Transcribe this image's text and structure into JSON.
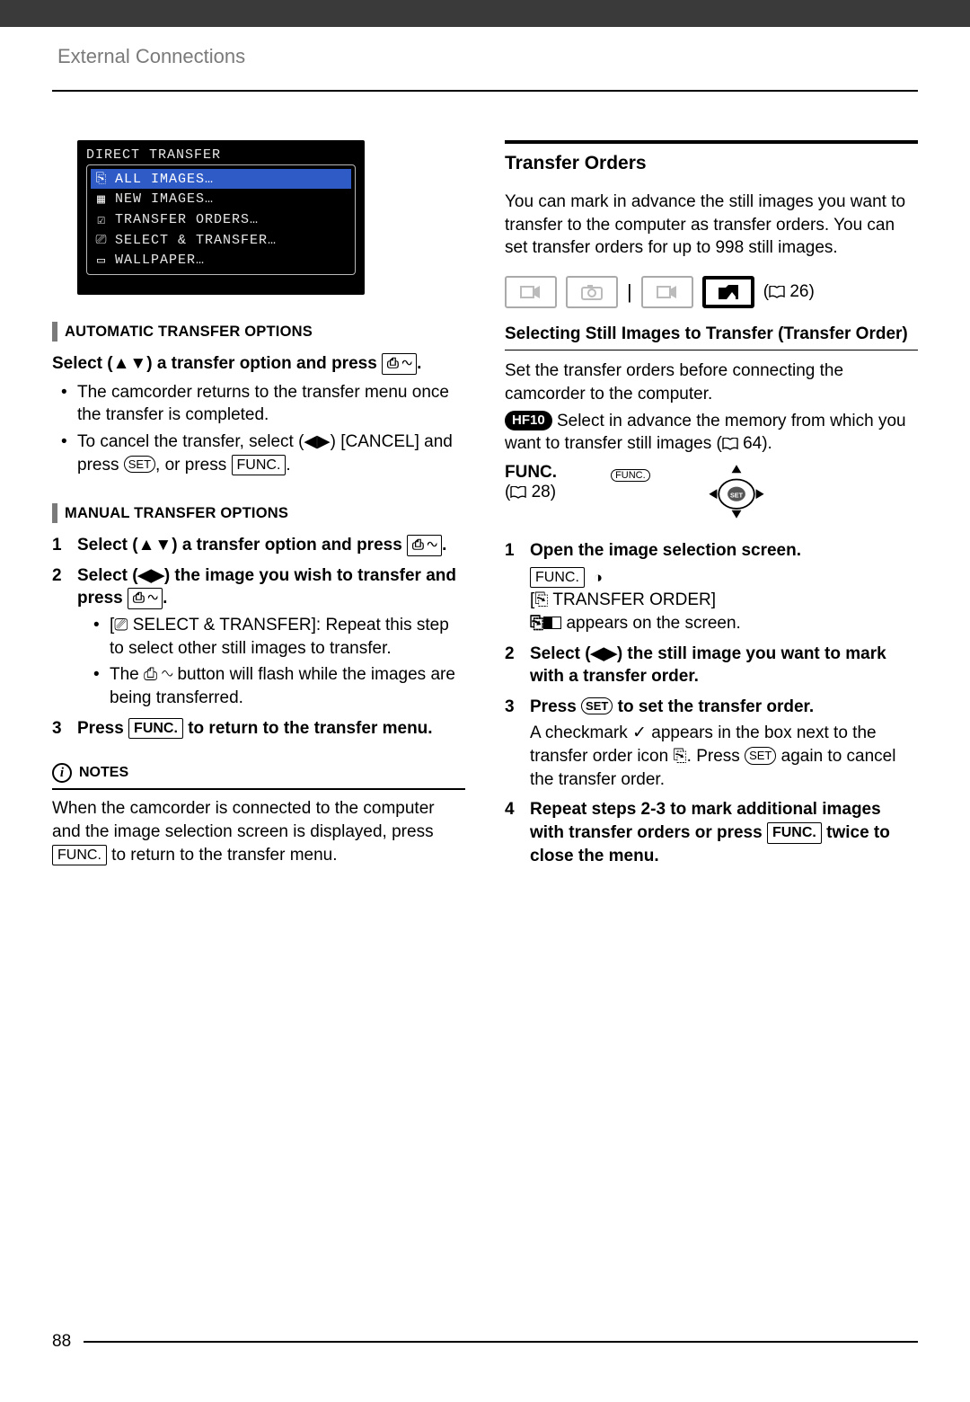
{
  "breadcrumb": "External Connections",
  "page_number": "88",
  "lcd": {
    "title": "DIRECT TRANSFER",
    "items": [
      {
        "label": "ALL IMAGES…"
      },
      {
        "label": "NEW IMAGES…"
      },
      {
        "label": "TRANSFER ORDERS…"
      },
      {
        "label": "SELECT & TRANSFER…"
      },
      {
        "label": "WALLPAPER…"
      }
    ]
  },
  "sections": {
    "auto_hdr": "Automatic transfer options",
    "manual_hdr": "Manual transfer options"
  },
  "left": {
    "lead_select": "Select (",
    "lead_select2": ") a transfer option and press ",
    "lead_end": ".",
    "bullet1": "The camcorder returns to the transfer menu once the transfer is completed.",
    "bullet2a": "To cancel the transfer, select (",
    "bullet2b": ") [CANCEL] and press ",
    "bullet2c": ", or press ",
    "bullet2d": ".",
    "set_label": "SET",
    "func_label": "FUNC.",
    "m_step1a": "Select (",
    "m_step1b": ") a transfer option and press ",
    "m_step1c": ".",
    "m_step2a": "Select (",
    "m_step2b": ") the image you wish to transfer and press ",
    "m_step2c": ".",
    "m_sub1a": "[",
    "m_sub1b": " SELECT & TRANSFER]: Repeat this step to select other still images to transfer.",
    "m_sub2a": "The ",
    "m_sub2b": " button will flash while the images are being transferred.",
    "m_step3a": "Press ",
    "m_step3b": " to return to the transfer menu.",
    "notes_label": "NOTES",
    "notes_body_a": "When the camcorder is connected to the computer and the image selection screen is displayed, press ",
    "notes_body_b": " to return to the transfer menu."
  },
  "right": {
    "heading": "Transfer Orders",
    "intro": "You can mark in advance the still images you want to transfer to the computer as transfer orders. You can set transfer orders for up to 998 still images.",
    "pageref": "26",
    "subhead": "Selecting Still Images to Transfer (Transfer Order)",
    "para1": "Set the transfer orders before connecting the camcorder to the computer.",
    "badge": "HF10",
    "para2a": " Select in advance the memory from which you want to transfer still images (",
    "para2b": " 64).",
    "func_label": "FUNC.",
    "func_ref": "28",
    "step1a": "Open the image selection screen.",
    "step1b": "[",
    "step1c": " TRANSFER ORDER]",
    "step1d": " appears on the screen.",
    "step2a": "Select (",
    "step2b": ") the still image you want to mark with a transfer order.",
    "step3a": "Press ",
    "step3b": " to set the transfer order.",
    "step3c": "A checkmark ",
    "step3d": " appears in the box next to the transfer order icon ",
    "step3e": ". Press ",
    "step3f": " again to cancel the transfer order.",
    "step4": "Repeat steps 2-3 to mark additional images with transfer orders or press ",
    "step4b": " twice to close the menu.",
    "set_label": "SET"
  }
}
